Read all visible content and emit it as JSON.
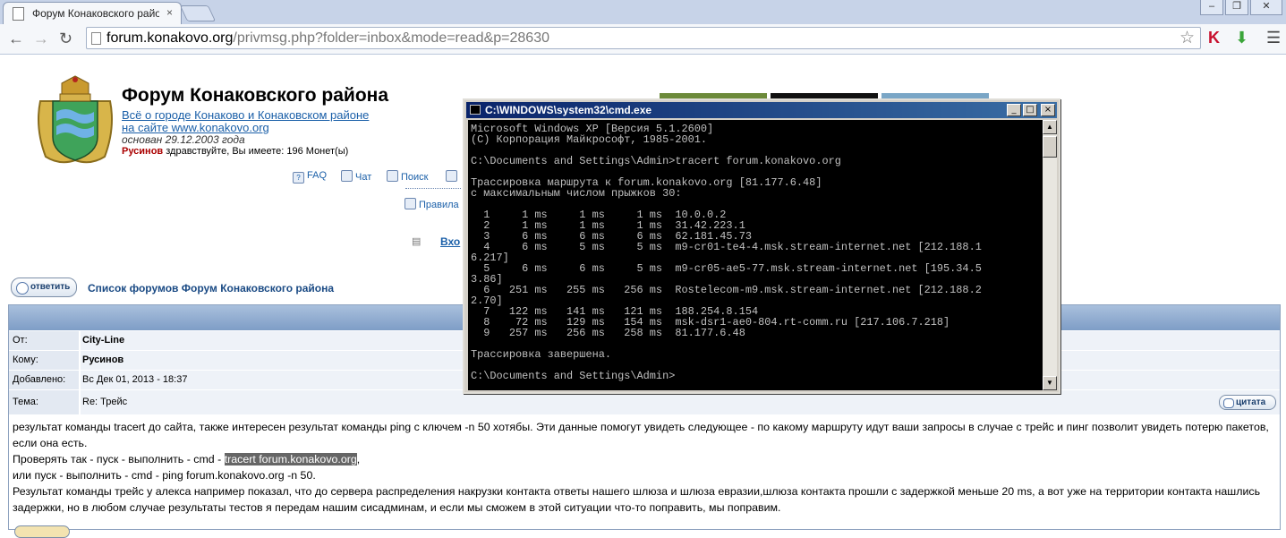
{
  "browser": {
    "tab_title": "Форум Конаковского район",
    "tab_close": "×",
    "url_host": "forum.konakovo.org",
    "url_path": "/privmsg.php?folder=inbox&mode=read&p=28630",
    "window_buttons": [
      "‒",
      "❐",
      "✕"
    ]
  },
  "site": {
    "title": "Форум Конаковского района",
    "link1": "Всё о городе Конаково и Конаковском районе",
    "link2": "на сайте www.konakovo.org",
    "founded": "основан 29.12.2003 года",
    "username": "Русинов",
    "greeting": " здравствуйте, Вы имеете: 196 Монет(ы)"
  },
  "nav": {
    "faq": "FAQ",
    "chat": "Чат",
    "search": "Поиск",
    "rules": "Правила",
    "login": "Вхо"
  },
  "actions": {
    "reply": "ответить",
    "forum_list": "Список форумов Форум Конаковского района",
    "quote": "цитата"
  },
  "message": {
    "fields": [
      {
        "label": "От:",
        "value": "City-Line",
        "bold": true
      },
      {
        "label": "Кому:",
        "value": "Русинов",
        "bold": true
      },
      {
        "label": "Добавлено:",
        "value": "Вс Дек 01, 2013 - 18:37",
        "bold": false
      },
      {
        "label": "Тема:",
        "value": "Re: Трейс",
        "bold": false
      }
    ],
    "line1": "результат команды tracert до сайта, также интересен результат команды ping с ключем -n 50 хотябы. Эти данные помогут увидеть следующее - по какому маршруту идут ваши запросы в случае с трейс и пинг позволит увидеть потерю пакетов, если она есть.",
    "line2_pre": "Проверять так - пуск - выполнить - cmd - ",
    "line2_hl": "tracert forum.konakovo.org",
    "line2_post": ",",
    "line3": "или пуск - выполнить - cmd - ping forum.konakovo.org -n 50.",
    "line4": "Результат команды трейс у алекса например показал, что до сервера распределения накрузки контакта ответы нашего шлюза и шлюза евразии,шлюза контакта прошли с задержкой меньше 20 ms, а вот уже на территории контакта нашлись задержки, но в любом случае результаты тестов я передам нашим сисадминам, и если мы сможем в этой ситуации что-то поправить, мы поправим."
  },
  "cmd": {
    "title": "C:\\WINDOWS\\system32\\cmd.exe",
    "output": "Microsoft Windows XP [Версия 5.1.2600]\n(С) Корпорация Майкрософт, 1985-2001.\n\nC:\\Documents and Settings\\Admin>tracert forum.konakovo.org\n\nТрассировка маршрута к forum.konakovo.org [81.177.6.48]\nс максимальным числом прыжков 30:\n\n  1     1 ms     1 ms     1 ms  10.0.0.2\n  2     1 ms     1 ms     1 ms  31.42.223.1\n  3     6 ms     6 ms     6 ms  62.181.45.73\n  4     6 ms     5 ms     5 ms  m9-cr01-te4-4.msk.stream-internet.net [212.188.1\n6.217]\n  5     6 ms     6 ms     5 ms  m9-cr05-ae5-77.msk.stream-internet.net [195.34.5\n3.86]\n  6   251 ms   255 ms   256 ms  Rostelecom-m9.msk.stream-internet.net [212.188.2\n2.70]\n  7   122 ms   141 ms   121 ms  188.254.8.154\n  8    72 ms   129 ms   154 ms  msk-dsr1-ae0-804.rt-comm.ru [217.106.7.218]\n  9   257 ms   256 ms   258 ms  81.177.6.48\n\nТрассировка завершена.\n\nC:\\Documents and Settings\\Admin>",
    "buttons": [
      "_",
      "□",
      "×"
    ]
  }
}
